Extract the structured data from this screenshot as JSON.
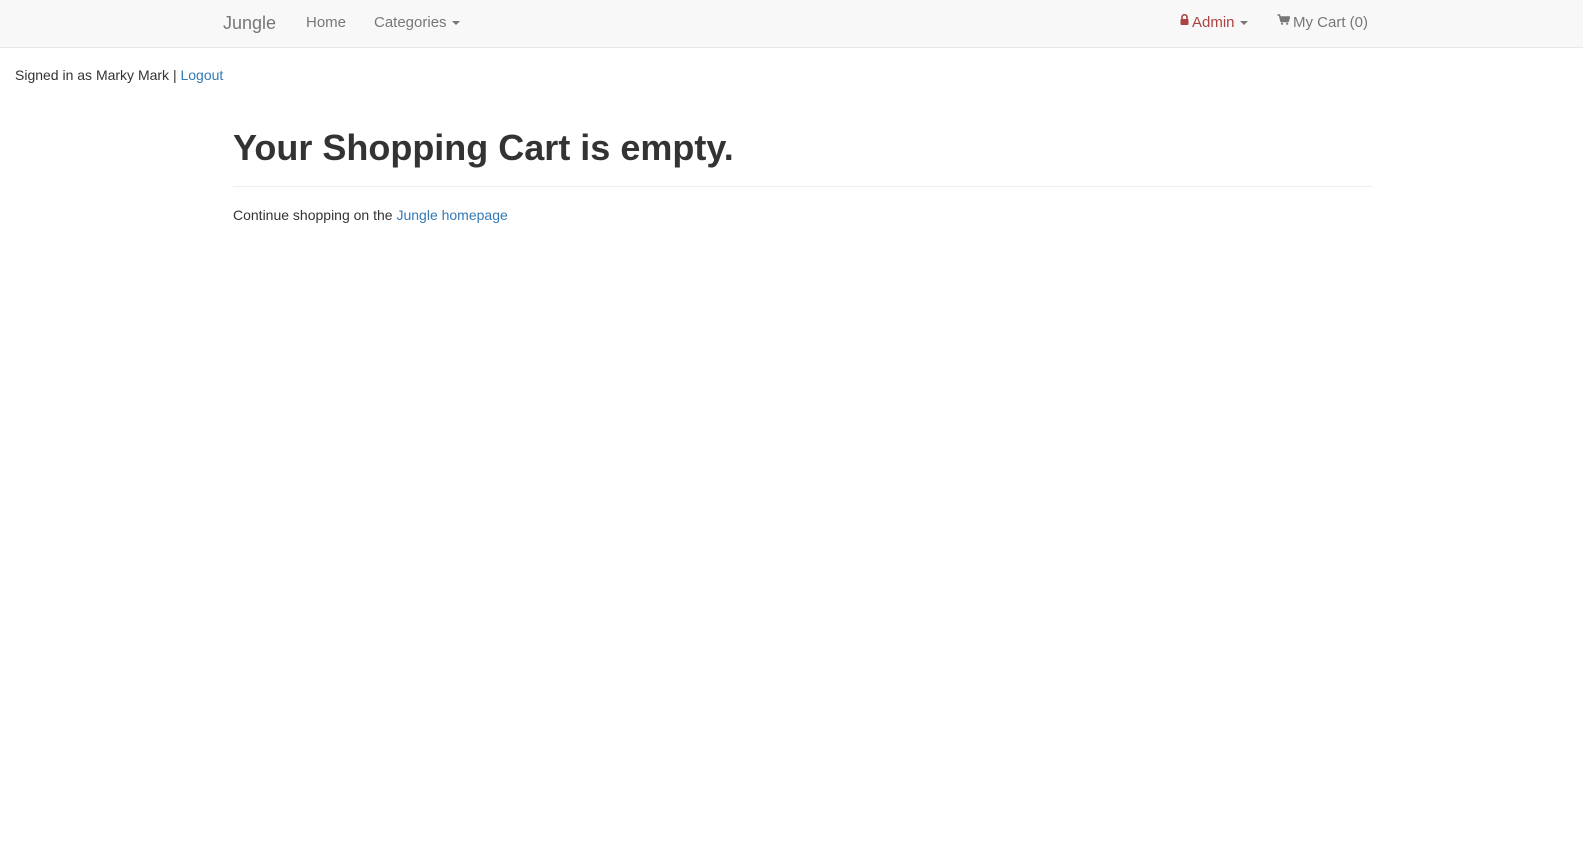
{
  "navbar": {
    "brand": "Jungle",
    "home": "Home",
    "categories": "Categories",
    "admin": "Admin",
    "cart": "My Cart (0)",
    "admin_color": "#a94442",
    "icons": {
      "admin": "lock-icon",
      "cart": "cart-icon",
      "dropdown": "caret-down-icon"
    }
  },
  "session": {
    "signed_in_text": "Signed in as Marky Mark |",
    "logout": "Logout"
  },
  "main": {
    "title": "Your Shopping Cart is empty.",
    "continue_text": "Continue shopping on the",
    "homepage_link": "Jungle homepage"
  }
}
